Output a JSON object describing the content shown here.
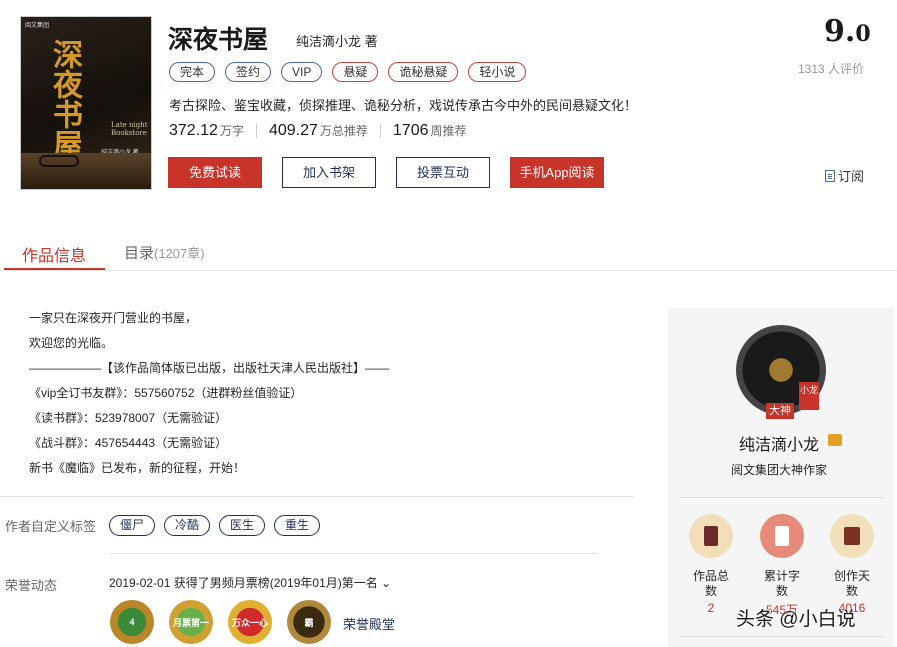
{
  "book": {
    "cover": {
      "title": "深夜书屋",
      "english": "Late night Bookstore",
      "author": "纯洁滴小龙 著",
      "logo": "阅文集团"
    },
    "title": "深夜书屋",
    "author": "纯洁滴小龙",
    "author_suffix": "著",
    "tags": [
      {
        "label": "完本",
        "style": "blue"
      },
      {
        "label": "签约",
        "style": "blue"
      },
      {
        "label": "VIP",
        "style": "blue"
      },
      {
        "label": "悬疑",
        "style": "red"
      },
      {
        "label": "诡秘悬疑",
        "style": "red"
      },
      {
        "label": "轻小说",
        "style": "red"
      }
    ],
    "intro": "考古探险、鉴宝收藏，侦探推理、诡秘分析，戏说传承古今中外的民间悬疑文化！",
    "stats": [
      {
        "value": "372.12",
        "unit": "万字"
      },
      {
        "value": "409.27",
        "unit": "万总推荐"
      },
      {
        "value": "1706",
        "unit": "周推荐"
      }
    ]
  },
  "actions": {
    "free_read": "免费试读",
    "add_shelf": "加入书架",
    "vote": "投票互动",
    "app_read": "手机App阅读",
    "subscribe": "订阅"
  },
  "rating": {
    "score_int": "9.",
    "score_dec": "0",
    "count": "1313 人评价"
  },
  "tabs": {
    "info": "作品信息",
    "toc": "目录",
    "toc_count": "(1207章)"
  },
  "description": [
    "一家只在深夜开门营业的书屋，",
    "欢迎您的光临。",
    "——————【该作品简体版已出版，出版社天津人民出版社】——",
    "《vip全订书友群》：557560752（进群粉丝值验证）",
    "《读书群》：523978007（无需验证）",
    "《战斗群》：457654443（无需验证）",
    "新书《魔临》已发布，新的征程，开始！"
  ],
  "author_tags": {
    "label": "作者自定义标签",
    "items": [
      "僵尸",
      "冷酷",
      "医生",
      "重生"
    ]
  },
  "honor": {
    "label": "荣誉动态",
    "text": "2019-02-01  获得了男频月票榜(2019年01月)第一名",
    "medals": [
      "4",
      "月票第一",
      "万众一心",
      "霸"
    ],
    "hall": "荣誉殿堂"
  },
  "author_card": {
    "badge": "小龙",
    "level_tag": "大神",
    "name": "纯洁滴小龙",
    "title": "阅文集团大神作家",
    "stats": [
      {
        "label": "作品总数",
        "value": "2"
      },
      {
        "label": "累计字数",
        "value": "545万"
      },
      {
        "label": "创作天数",
        "value": "4016"
      }
    ]
  },
  "watermark": "头条 @小白说",
  "colors": {
    "accent": "#c8342a",
    "navy": "#1f2f5a"
  }
}
